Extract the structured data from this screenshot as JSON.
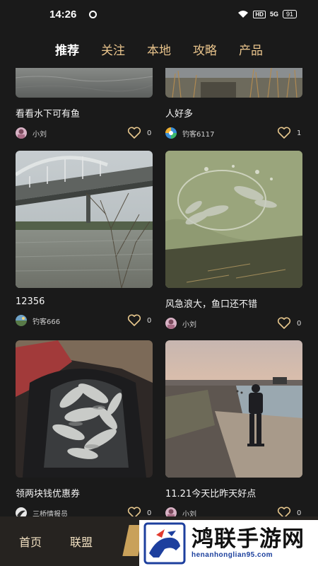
{
  "status_bar": {
    "time": "14:26",
    "hd": "HD",
    "signal": "5G",
    "battery": "91"
  },
  "tabs": [
    {
      "label": "推荐",
      "active": true
    },
    {
      "label": "关注",
      "active": false
    },
    {
      "label": "本地",
      "active": false
    },
    {
      "label": "攻略",
      "active": false
    },
    {
      "label": "产品",
      "active": false
    }
  ],
  "posts": [
    {
      "title": "看看水下可有鱼",
      "author": "小刘",
      "likes": "0",
      "image": "murky water surface",
      "avatar": "avatar-xiaoliu"
    },
    {
      "title": "人好多",
      "author": "钓客6117",
      "likes": "1",
      "image": "reeds by the water",
      "avatar": "avatar-colorful"
    },
    {
      "title": "12356",
      "author": "钓客666",
      "likes": "0",
      "image": "river under bridge",
      "avatar": "avatar-landscape"
    },
    {
      "title": "风急浪大，鱼口还不错",
      "author": "小刘",
      "likes": "0",
      "image": "fish in landing net",
      "avatar": "avatar-xiaoliu"
    },
    {
      "title": "领两块钱优惠券",
      "author": "三桥情报员",
      "likes": "0",
      "image": "fish in bucket",
      "avatar": "avatar-bird"
    },
    {
      "title": "11.21今天比昨天好点",
      "author": "小刘",
      "likes": "0",
      "image": "man on shore at dusk",
      "avatar": "avatar-xiaoliu"
    }
  ],
  "bottom_nav": {
    "home": "首页",
    "league": "联盟"
  },
  "watermark": {
    "title": "鸿联手游网",
    "url": "henanhonglian95.com"
  },
  "colors": {
    "background": "#1a1a1a",
    "tab_inactive": "#e9c48c",
    "tab_active": "#ffffff",
    "bottom_nav_bg": "#262320"
  },
  "icons": [
    "wifi-icon",
    "heart-icon",
    "camera-indicator-icon"
  ]
}
